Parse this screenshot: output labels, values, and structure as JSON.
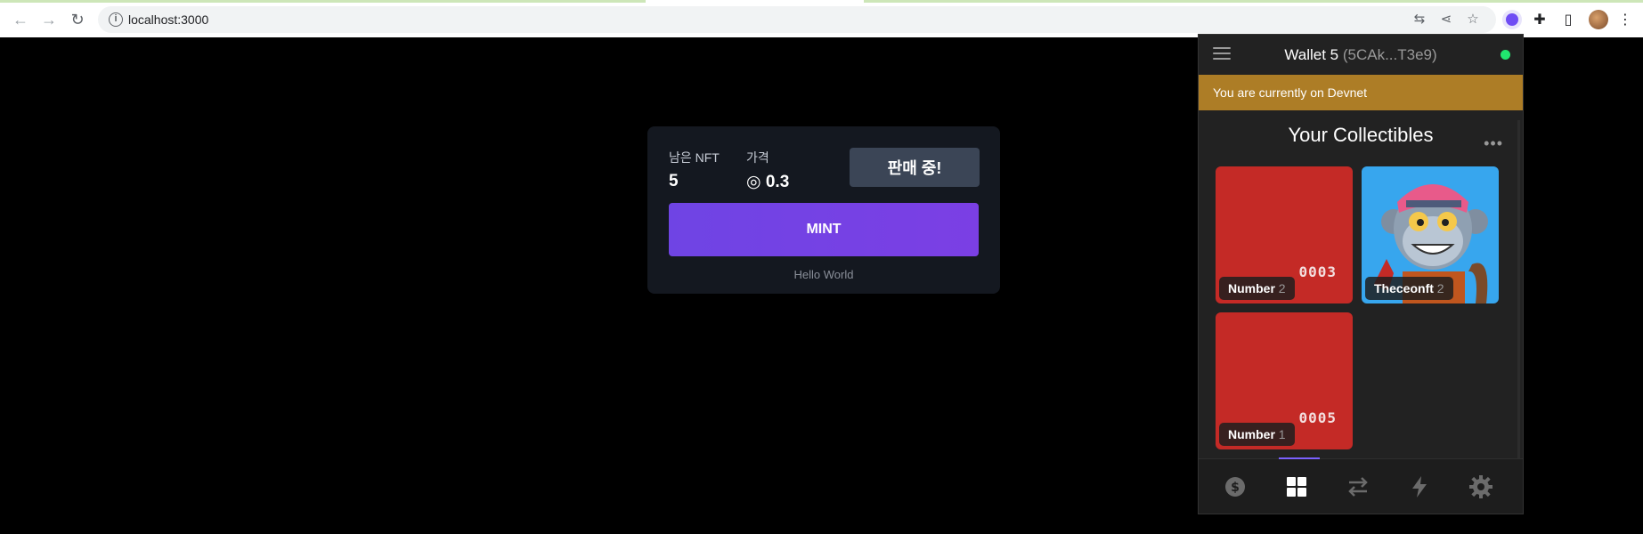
{
  "browser": {
    "url": "localhost:3000"
  },
  "mint_card": {
    "remaining_label": "남은 NFT",
    "remaining_value": "5",
    "price_label": "가격",
    "price_value": "◎ 0.3",
    "sale_button": "판매 중!",
    "mint_button": "MINT",
    "footer": "Hello World"
  },
  "wallet": {
    "name": "Wallet 5",
    "address_short": "(5CAk...T3e9)",
    "network_banner": "You are currently on Devnet",
    "collectibles_title": "Your Collectibles",
    "more_label": "•••",
    "status_color": "#21e56f",
    "items": [
      {
        "name": "Number",
        "count": "2",
        "number_text": "0003",
        "color": "#c42a26"
      },
      {
        "name": "Theceonft",
        "count": "2",
        "color": "#37a6ee"
      },
      {
        "name": "Number",
        "count": "1",
        "number_text": "0005",
        "color": "#c42a26"
      }
    ],
    "nav": [
      "dollar-icon",
      "grid-icon",
      "swap-icon",
      "bolt-icon",
      "gear-icon"
    ],
    "active_tab": "grid-icon"
  }
}
